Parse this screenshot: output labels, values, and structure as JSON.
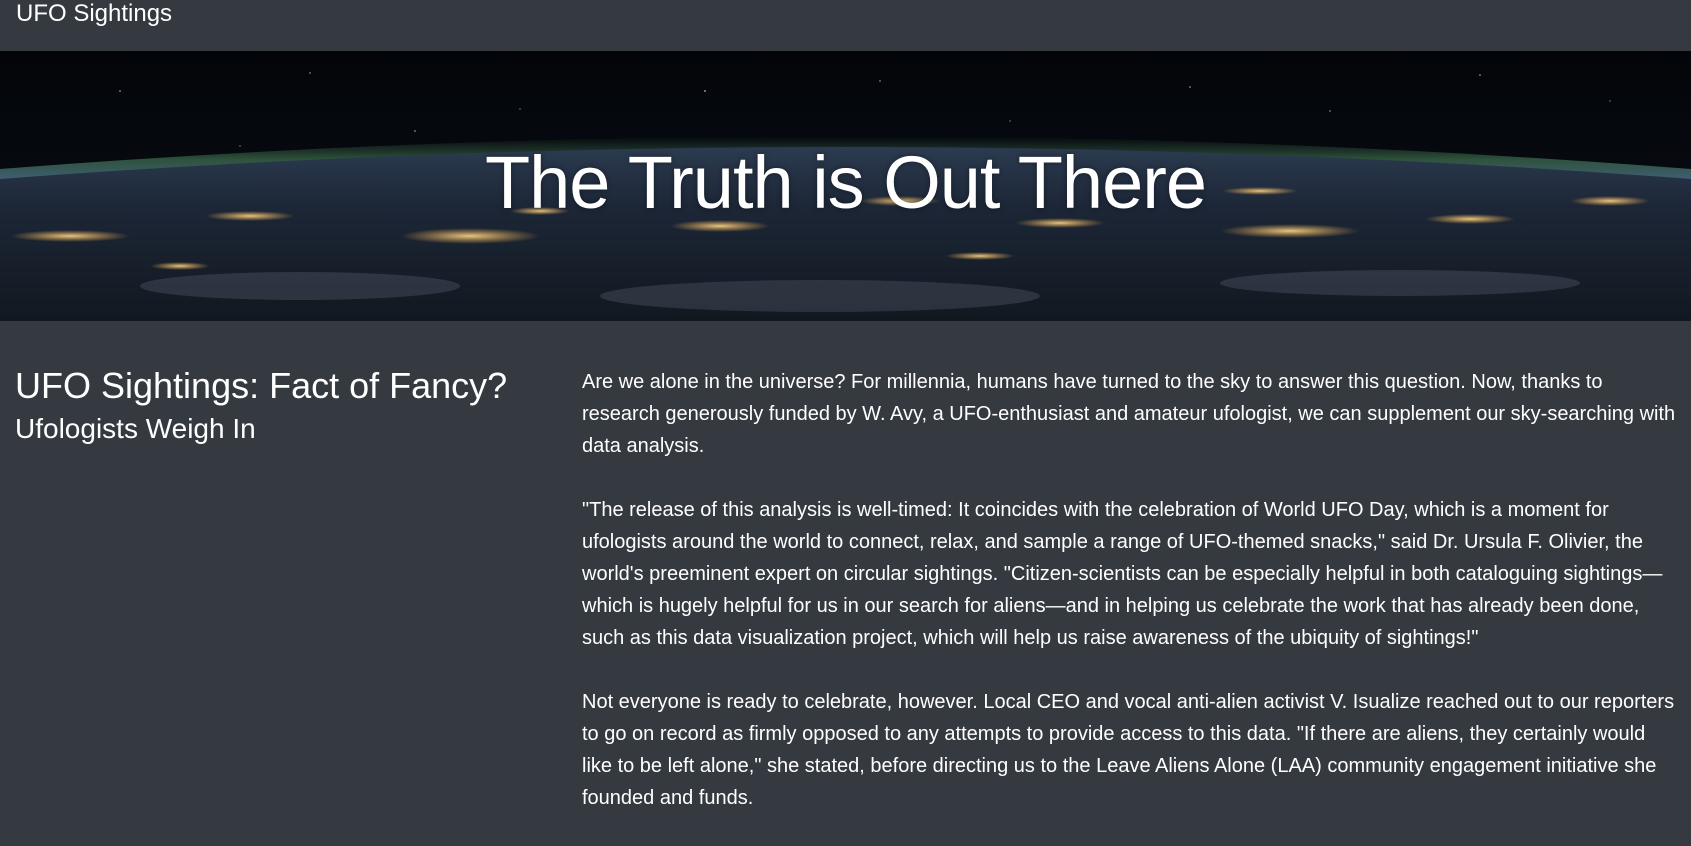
{
  "navbar": {
    "brand": "UFO Sightings"
  },
  "hero": {
    "title": "The Truth is Out There"
  },
  "headline": {
    "title": "UFO Sightings: Fact of Fancy?",
    "subtitle": "Ufologists Weigh In"
  },
  "article": {
    "paragraphs": [
      "Are we alone in the universe? For millennia, humans have turned to the sky to answer this question. Now, thanks to research generously funded by W. Avy, a UFO-enthusiast and amateur ufologist, we can supplement our sky-searching with data analysis.",
      "\"The release of this analysis is well-timed: It coincides with the celebration of World UFO Day, which is a moment for ufologists around the world to connect, relax, and sample a range of UFO-themed snacks,\" said Dr. Ursula F. Olivier, the world's preeminent expert on circular sightings. \"Citizen-scientists can be especially helpful in both cataloguing sightings—which is hugely helpful for us in our search for aliens—and in helping us celebrate the work that has already been done, such as this data visualization project, which will help us raise awareness of the ubiquity of sightings!\"",
      "Not everyone is ready to celebrate, however. Local CEO and vocal anti-alien activist V. Isualize reached out to our reporters to go on record as firmly opposed to any attempts to provide access to this data. \"If there are aliens, they certainly would like to be left alone,\" she stated, before directing us to the Leave Aliens Alone (LAA) community engagement initiative she founded and funds."
    ]
  },
  "colors": {
    "background": "#343a40",
    "text": "#ffffff"
  }
}
